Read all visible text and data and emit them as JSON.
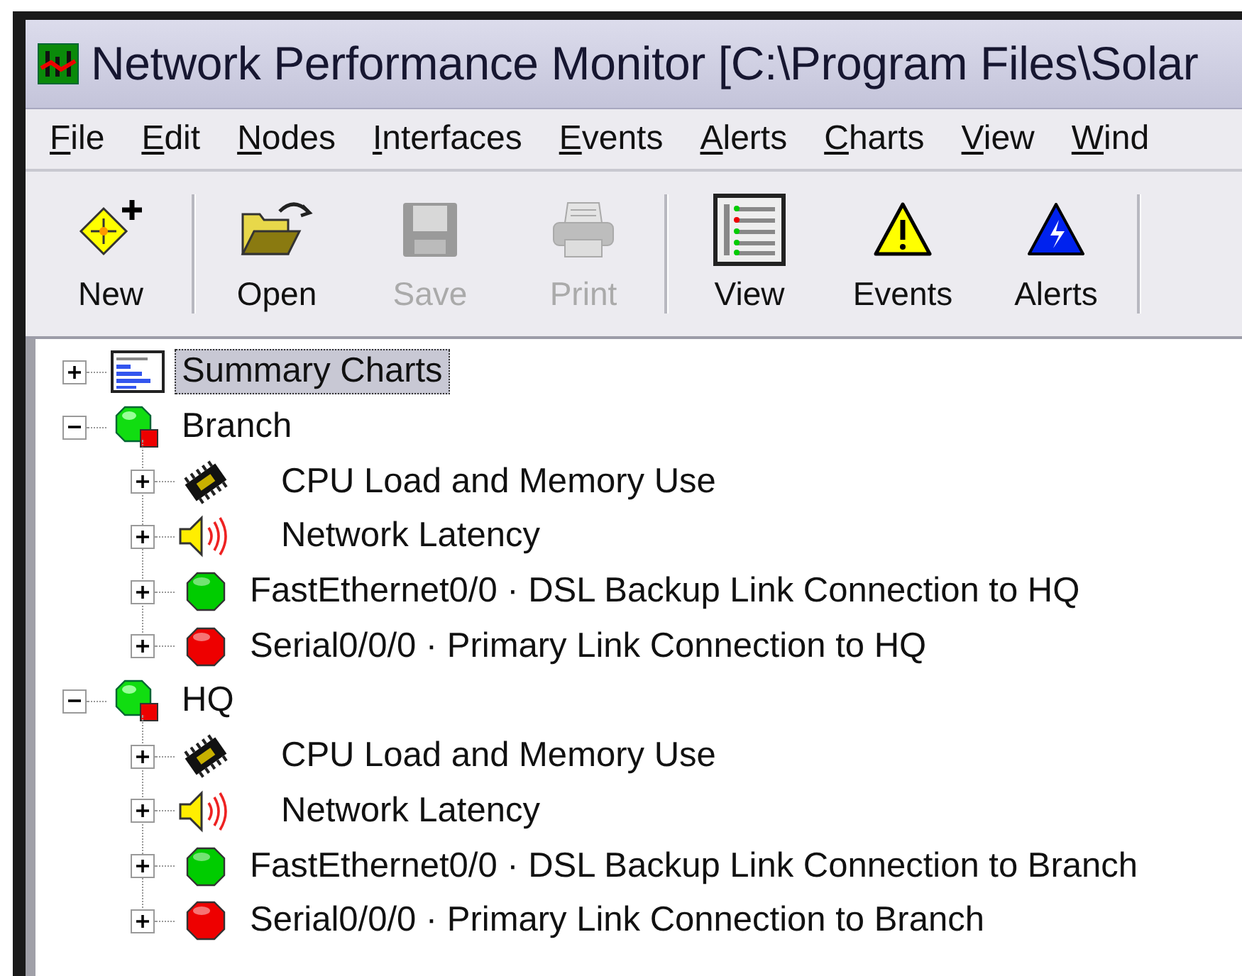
{
  "window": {
    "title": "Network Performance Monitor [C:\\Program Files\\Solar"
  },
  "menu": [
    "File",
    "Edit",
    "Nodes",
    "Interfaces",
    "Events",
    "Alerts",
    "Charts",
    "View",
    "Wind"
  ],
  "toolbar": [
    {
      "kind": "new",
      "label": "New",
      "disabled": false
    },
    {
      "kind": "separator"
    },
    {
      "kind": "open",
      "label": "Open",
      "disabled": false
    },
    {
      "kind": "save",
      "label": "Save",
      "disabled": true
    },
    {
      "kind": "print",
      "label": "Print",
      "disabled": true
    },
    {
      "kind": "separator"
    },
    {
      "kind": "view",
      "label": "View",
      "disabled": false
    },
    {
      "kind": "events",
      "label": "Events",
      "disabled": false
    },
    {
      "kind": "alerts",
      "label": "Alerts",
      "disabled": false
    },
    {
      "kind": "separator"
    }
  ],
  "tree": [
    {
      "kind": "summary",
      "label": "Summary Charts",
      "expanded": false,
      "selected": true
    },
    {
      "kind": "node",
      "label": "Branch",
      "expanded": true,
      "selected": false,
      "children": [
        {
          "kind": "cpu",
          "label": "CPU Load and Memory Use",
          "expanded": false,
          "selected": false
        },
        {
          "kind": "latency",
          "label": "Network Latency",
          "expanded": false,
          "selected": false
        },
        {
          "kind": "interface",
          "label": "FastEthernet0/0 · DSL Backup Link Connection to HQ",
          "expanded": false,
          "selected": false,
          "color": "#00cc00"
        },
        {
          "kind": "interface",
          "label": "Serial0/0/0 · Primary Link Connection to HQ",
          "expanded": false,
          "selected": false,
          "color": "#ee0000"
        }
      ]
    },
    {
      "kind": "node",
      "label": "HQ",
      "expanded": true,
      "selected": false,
      "children": [
        {
          "kind": "cpu",
          "label": "CPU Load and Memory Use",
          "expanded": false,
          "selected": false
        },
        {
          "kind": "latency",
          "label": "Network Latency",
          "expanded": false,
          "selected": false
        },
        {
          "kind": "interface",
          "label": "FastEthernet0/0 · DSL Backup Link Connection to Branch",
          "expanded": false,
          "selected": false,
          "color": "#00cc00"
        },
        {
          "kind": "interface",
          "label": "Serial0/0/0 · Primary Link Connection to Branch",
          "expanded": false,
          "selected": false,
          "color": "#ee0000"
        }
      ]
    }
  ]
}
